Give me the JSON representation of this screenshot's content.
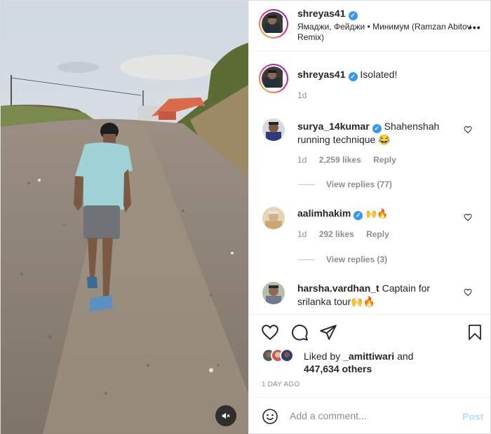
{
  "post": {
    "author": "shreyas41",
    "song": "Ямаджи, Фейджи • Минимум (Ramzan Abitov Remix)",
    "more": "•••"
  },
  "caption": {
    "author": "shreyas41",
    "text": "Isolated!",
    "time": "1d"
  },
  "comments": [
    {
      "author": "surya_14kumar",
      "verified": true,
      "text": "Shahenshah running technique 😂",
      "time": "1d",
      "likes": "2,259 likes",
      "reply": "Reply",
      "view_replies": "View replies (77)"
    },
    {
      "author": "aalimhakim",
      "verified": true,
      "text": "🙌🔥",
      "time": "1d",
      "likes": "292 likes",
      "reply": "Reply",
      "view_replies": "View replies (3)"
    },
    {
      "author": "harsha.vardhan_t",
      "verified": false,
      "text": "Captain for srilanka tour🙌🔥"
    }
  ],
  "likes": {
    "prefix": "Liked by",
    "user": "_amittiwari",
    "and": "and",
    "count": "447,634 others"
  },
  "date": "1 DAY AGO",
  "add_comment": {
    "placeholder": "Add a comment...",
    "post_label": "Post"
  },
  "icons": {
    "heart": "heart-icon",
    "comment": "comment-icon",
    "share": "share-icon",
    "save": "bookmark-icon",
    "emoji": "emoji-icon",
    "mute": "muted-speaker-icon",
    "verified": "verified-badge-icon"
  },
  "colors": {
    "verified": "#3897f0",
    "post_button_disabled": "#b2dffc",
    "meta_text": "#8e8e8e"
  }
}
